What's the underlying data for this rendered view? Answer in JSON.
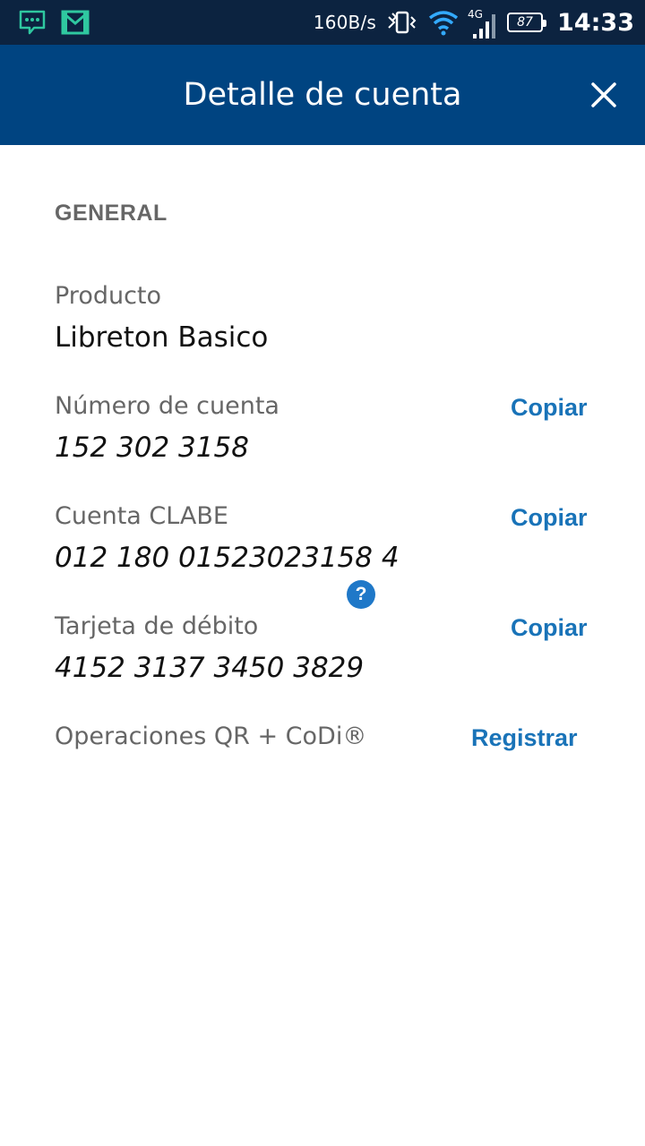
{
  "status_bar": {
    "net_speed": "160B/s",
    "network_type": "4G",
    "battery_level": "87",
    "time": "14:33",
    "icons": [
      "message-icon",
      "gmail-icon",
      "bluetooth-icon",
      "vibrate-icon",
      "wifi-icon",
      "signal-icon",
      "battery-icon"
    ]
  },
  "header": {
    "title": "Detalle de cuenta",
    "close_icon": "close-icon"
  },
  "general": {
    "section_title": "GENERAL",
    "product_label": "Producto",
    "product_value": "Libreton Basico",
    "account_number_label": "Número de cuenta",
    "account_number_value": "152 302 3158",
    "clabe_label": "Cuenta CLABE",
    "clabe_value": "012 180 01523023158 4",
    "debit_card_label": "Tarjeta de débito",
    "debit_card_value": "4152 3137 3450 3829",
    "copy_label": "Copiar",
    "qr_codi_label": "Operaciones QR + CoDi®",
    "help_glyph": "?",
    "register_label": "Registrar"
  },
  "colors": {
    "status_bar": "#0c2340",
    "app_bar": "#004481",
    "accent_link": "#1973b8",
    "label_gray": "#666666",
    "value_text": "#121212"
  }
}
